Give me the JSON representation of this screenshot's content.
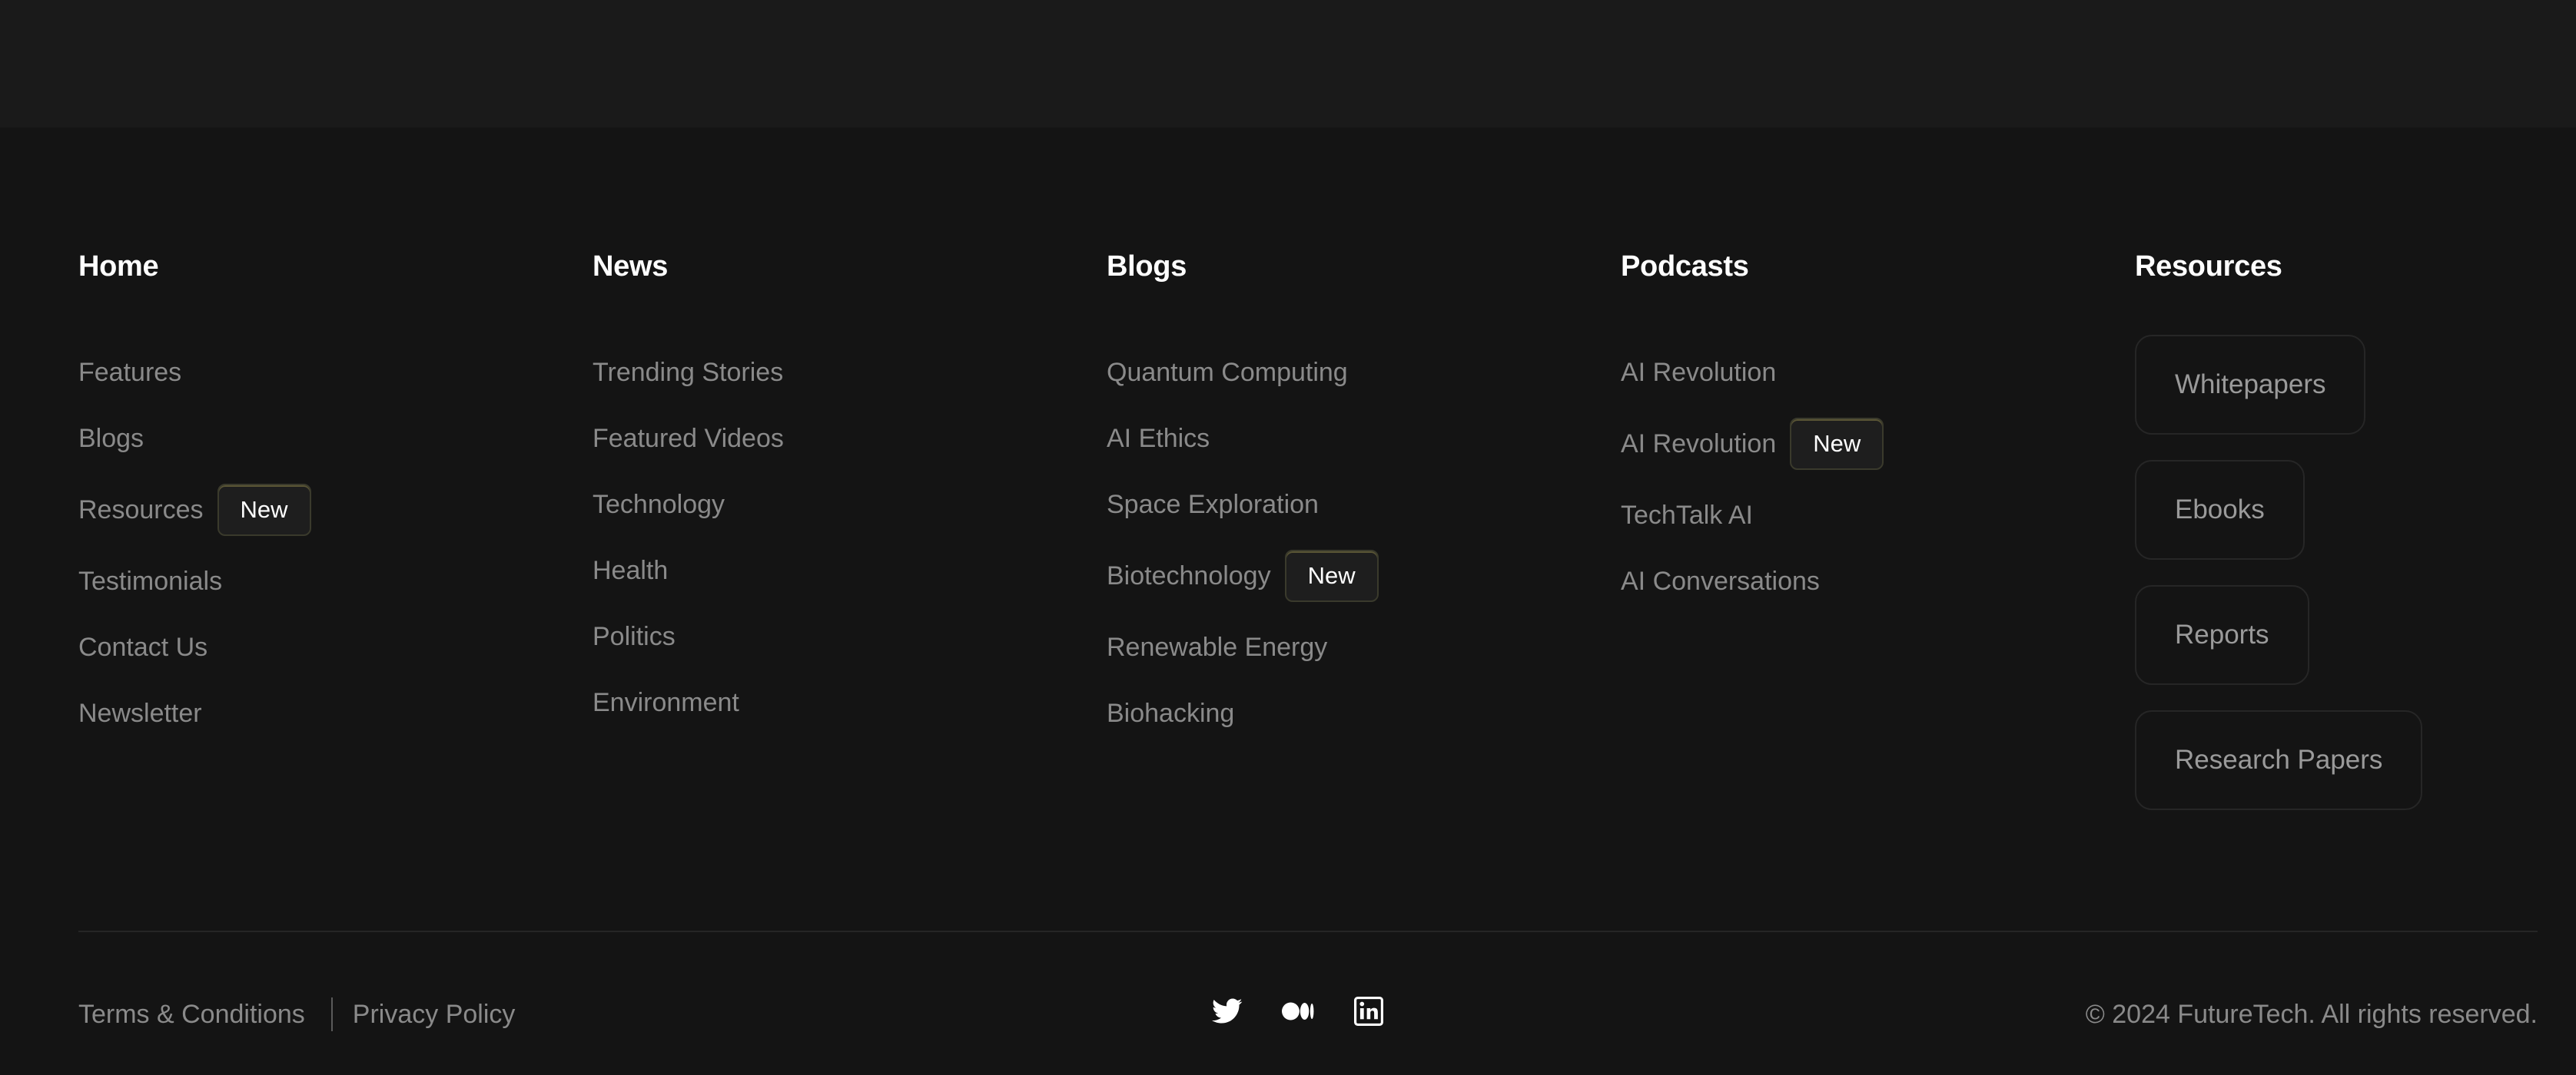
{
  "columns": [
    {
      "title": "Home",
      "links": [
        {
          "label": "Features"
        },
        {
          "label": "Blogs"
        },
        {
          "label": "Resources",
          "badge": "New"
        },
        {
          "label": "Testimonials"
        },
        {
          "label": "Contact Us"
        },
        {
          "label": "Newsletter"
        }
      ]
    },
    {
      "title": "News",
      "links": [
        {
          "label": "Trending Stories"
        },
        {
          "label": "Featured Videos"
        },
        {
          "label": "Technology"
        },
        {
          "label": "Health"
        },
        {
          "label": "Politics"
        },
        {
          "label": "Environment"
        }
      ]
    },
    {
      "title": "Blogs",
      "links": [
        {
          "label": "Quantum Computing"
        },
        {
          "label": "AI Ethics"
        },
        {
          "label": "Space Exploration"
        },
        {
          "label": "Biotechnology",
          "badge": "New"
        },
        {
          "label": "Renewable Energy"
        },
        {
          "label": "Biohacking"
        }
      ]
    },
    {
      "title": "Podcasts",
      "links": [
        {
          "label": "AI Revolution"
        },
        {
          "label": "AI Revolution",
          "badge": "New"
        },
        {
          "label": "TechTalk AI"
        },
        {
          "label": "AI Conversations"
        }
      ]
    }
  ],
  "resources": {
    "title": "Resources",
    "items": [
      "Whitepapers",
      "Ebooks",
      "Reports",
      "Research Papers"
    ]
  },
  "bottom": {
    "terms": "Terms & Conditions",
    "privacy": "Privacy Policy",
    "copyright": "© 2024 FutureTech. All rights reserved.",
    "socials": [
      "twitter-icon",
      "medium-icon",
      "linkedin-icon"
    ]
  },
  "colors": {
    "background": "#141414",
    "top_band": "#1a1a1a",
    "muted_text": "#8a8a8a",
    "badge_accent": "#cabc60"
  }
}
